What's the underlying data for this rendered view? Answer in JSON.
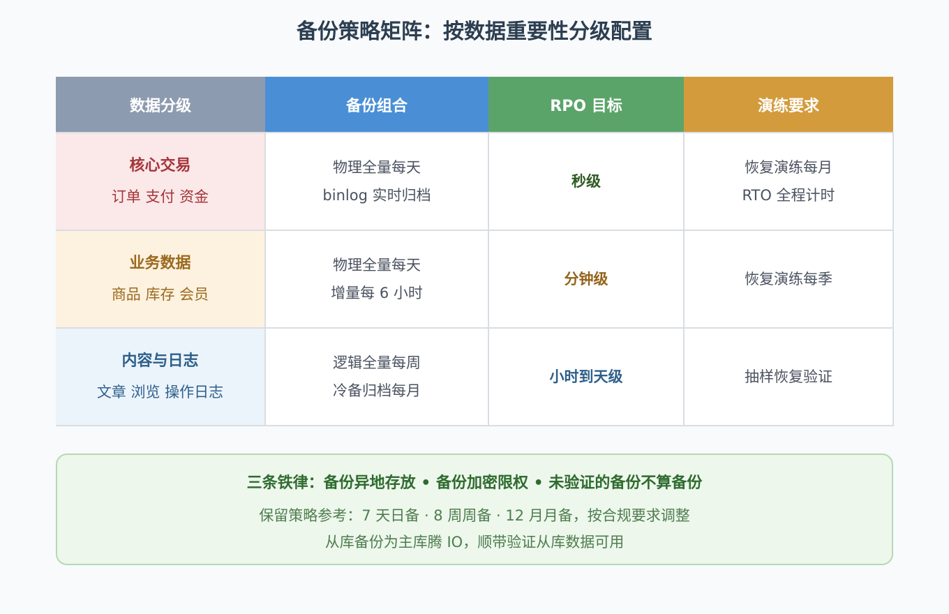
{
  "title": "备份策略矩阵：按数据重要性分级配置",
  "colors": {
    "header_tier": "#8d9bb0",
    "header_backup": "#4a8fd6",
    "header_rpo": "#5ba469",
    "header_drill": "#d49b3c",
    "core_bg": "#fbe8e8",
    "core_text": "#a4363b",
    "business_bg": "#fdf1df",
    "business_text": "#9a6a1f",
    "content_bg": "#ecf4fb",
    "content_text": "#2d5f8b",
    "rpo_core": "#2e5a23",
    "rpo_business": "#94631a",
    "rpo_content": "#2d5f8b"
  },
  "table": {
    "headers": [
      "数据分级",
      "备份组合",
      "RPO 目标",
      "演练要求"
    ],
    "rows": [
      {
        "tier_name": "核心交易",
        "tier_desc": "订单 支付 资金",
        "backup": [
          "物理全量每天",
          "binlog 实时归档"
        ],
        "rpo": "秒级",
        "drill": [
          "恢复演练每月",
          "RTO 全程计时"
        ]
      },
      {
        "tier_name": "业务数据",
        "tier_desc": "商品 库存 会员",
        "backup": [
          "物理全量每天",
          "增量每 6 小时"
        ],
        "rpo": "分钟级",
        "drill": [
          "恢复演练每季"
        ]
      },
      {
        "tier_name": "内容与日志",
        "tier_desc": "文章 浏览 操作日志",
        "backup": [
          "逻辑全量每周",
          "冷备归档每月"
        ],
        "rpo": "小时到天级",
        "drill": [
          "抽样恢复验证"
        ]
      }
    ]
  },
  "rules": {
    "title": "三条铁律：备份异地存放 • 备份加密限权 • 未验证的备份不算备份",
    "lines": [
      "保留策略参考：7 天日备 · 8 周周备 · 12 月月备，按合规要求调整",
      "从库备份为主库腾 IO，顺带验证从库数据可用"
    ]
  }
}
